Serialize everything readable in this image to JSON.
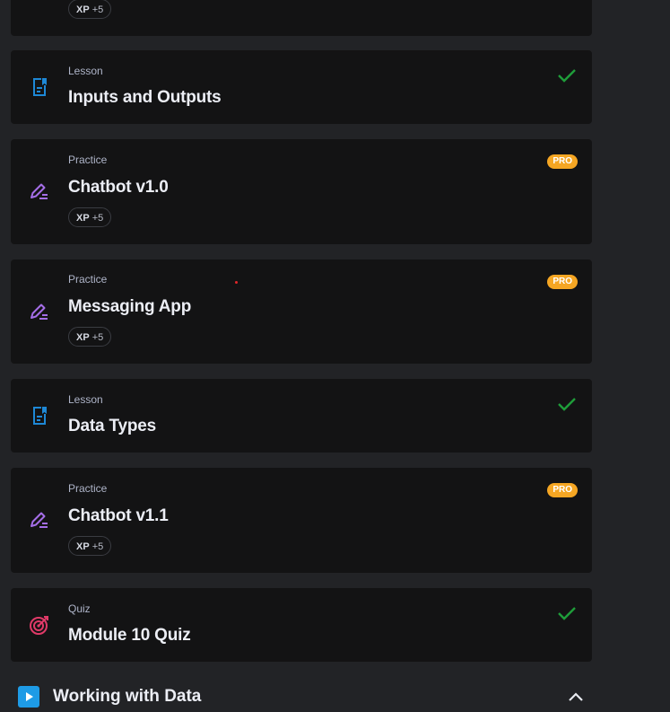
{
  "colors": {
    "lesson_icon": "#1e88d6",
    "practice_icon": "#a56ee8",
    "quiz_icon": "#e03a68",
    "check": "#1f9d3a",
    "pro_badge": "#f5a623",
    "section_icon": "#1e9be6"
  },
  "top_partial_card": {
    "xp_label": "XP",
    "xp_value": "+5"
  },
  "items": [
    {
      "kind": "Lesson",
      "title": "Inputs and Outputs",
      "icon": "lesson-doc-icon",
      "completed": true
    },
    {
      "kind": "Practice",
      "title": "Chatbot v1.0",
      "icon": "pencil-icon",
      "badge": "PRO",
      "xp_label": "XP",
      "xp_value": "+5"
    },
    {
      "kind": "Practice",
      "title": "Messaging App",
      "icon": "pencil-icon",
      "badge": "PRO",
      "xp_label": "XP",
      "xp_value": "+5"
    },
    {
      "kind": "Lesson",
      "title": "Data Types",
      "icon": "lesson-doc-icon",
      "completed": true
    },
    {
      "kind": "Practice",
      "title": "Chatbot v1.1",
      "icon": "pencil-icon",
      "badge": "PRO",
      "xp_label": "XP",
      "xp_value": "+5"
    },
    {
      "kind": "Quiz",
      "title": "Module 10 Quiz",
      "icon": "target-icon",
      "completed": true
    }
  ],
  "section": {
    "title": "Working with Data",
    "icon": "play-icon",
    "expanded": true
  }
}
